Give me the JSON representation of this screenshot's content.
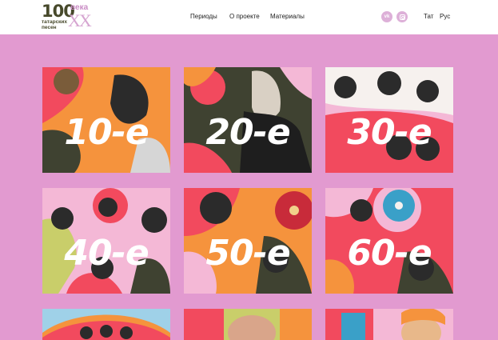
{
  "header": {
    "logo": {
      "number": "100",
      "century_word": "века",
      "century_numeral": "XX",
      "subtitle_line1": "татарских",
      "subtitle_line2": "песен"
    },
    "nav": {
      "periods": "Периоды",
      "about": "О проекте",
      "materials": "Материалы"
    },
    "social": {
      "vk": "vk",
      "instagram_icon": "instagram-icon"
    },
    "languages": {
      "tat": "Тат",
      "rus": "Рус"
    }
  },
  "decades": [
    {
      "label": "10-е"
    },
    {
      "label": "20-е"
    },
    {
      "label": "30-е"
    },
    {
      "label": "40-е"
    },
    {
      "label": "50-е"
    },
    {
      "label": "60-е"
    }
  ],
  "colors": {
    "page_background": "#e29ad0",
    "header_background": "#ffffff",
    "accent_red": "#f24a5e",
    "accent_orange": "#f5933d",
    "dark_olive": "#3f4231",
    "light_pink": "#f4b8d6",
    "logo_text": "#47492b"
  }
}
